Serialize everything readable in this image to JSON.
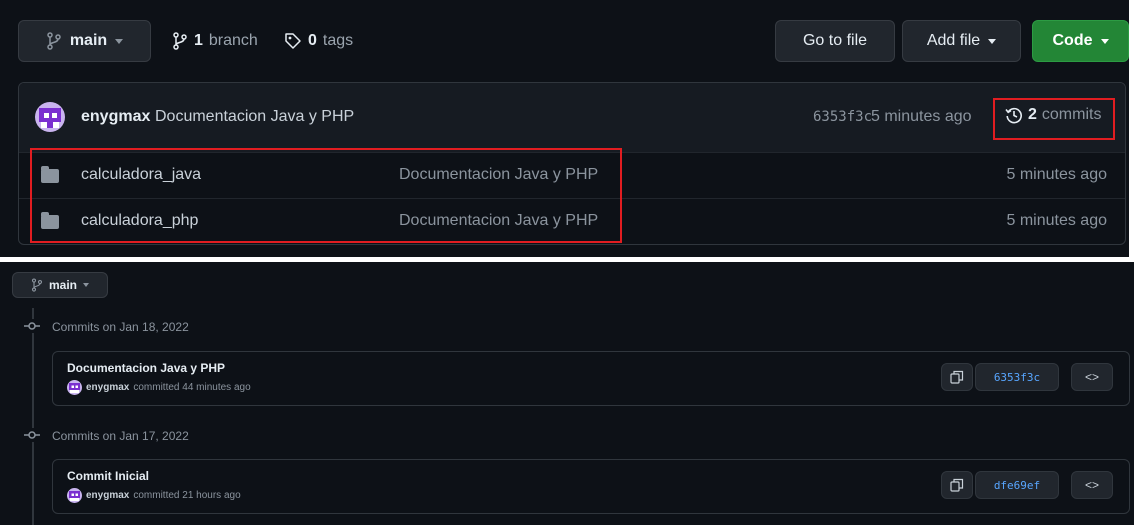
{
  "top": {
    "branch_button": "main",
    "branches_count": "1",
    "branches_label": "branch",
    "tags_count": "0",
    "tags_label": "tags",
    "go_to_file": "Go to file",
    "add_file": "Add file",
    "code": "Code",
    "latest_commit": {
      "author": "enygmax",
      "message": "Documentacion Java y PHP",
      "sha": "6353f3c",
      "age": "5 minutes ago",
      "commits_count": "2",
      "commits_label": "commits"
    },
    "files": [
      {
        "name": "calculadora_java",
        "message": "Documentacion Java y PHP",
        "age": "5 minutes ago"
      },
      {
        "name": "calculadora_php",
        "message": "Documentacion Java y PHP",
        "age": "5 minutes ago"
      }
    ]
  },
  "bottom": {
    "branch_button": "main",
    "groups": [
      {
        "date_label": "Commits on Jan 18, 2022",
        "commit": {
          "title": "Documentacion Java y PHP",
          "author": "enygmax",
          "action": "committed 44 minutes ago",
          "sha": "6353f3c"
        }
      },
      {
        "date_label": "Commits on Jan 17, 2022",
        "commit": {
          "title": "Commit Inicial",
          "author": "enygmax",
          "action": "committed 21 hours ago",
          "sha": "dfe69ef"
        }
      }
    ]
  },
  "colors": {
    "background": "#0d1117",
    "green_button": "#238636",
    "highlight_box": "#e11d21",
    "sha_link": "#58a6ff"
  }
}
